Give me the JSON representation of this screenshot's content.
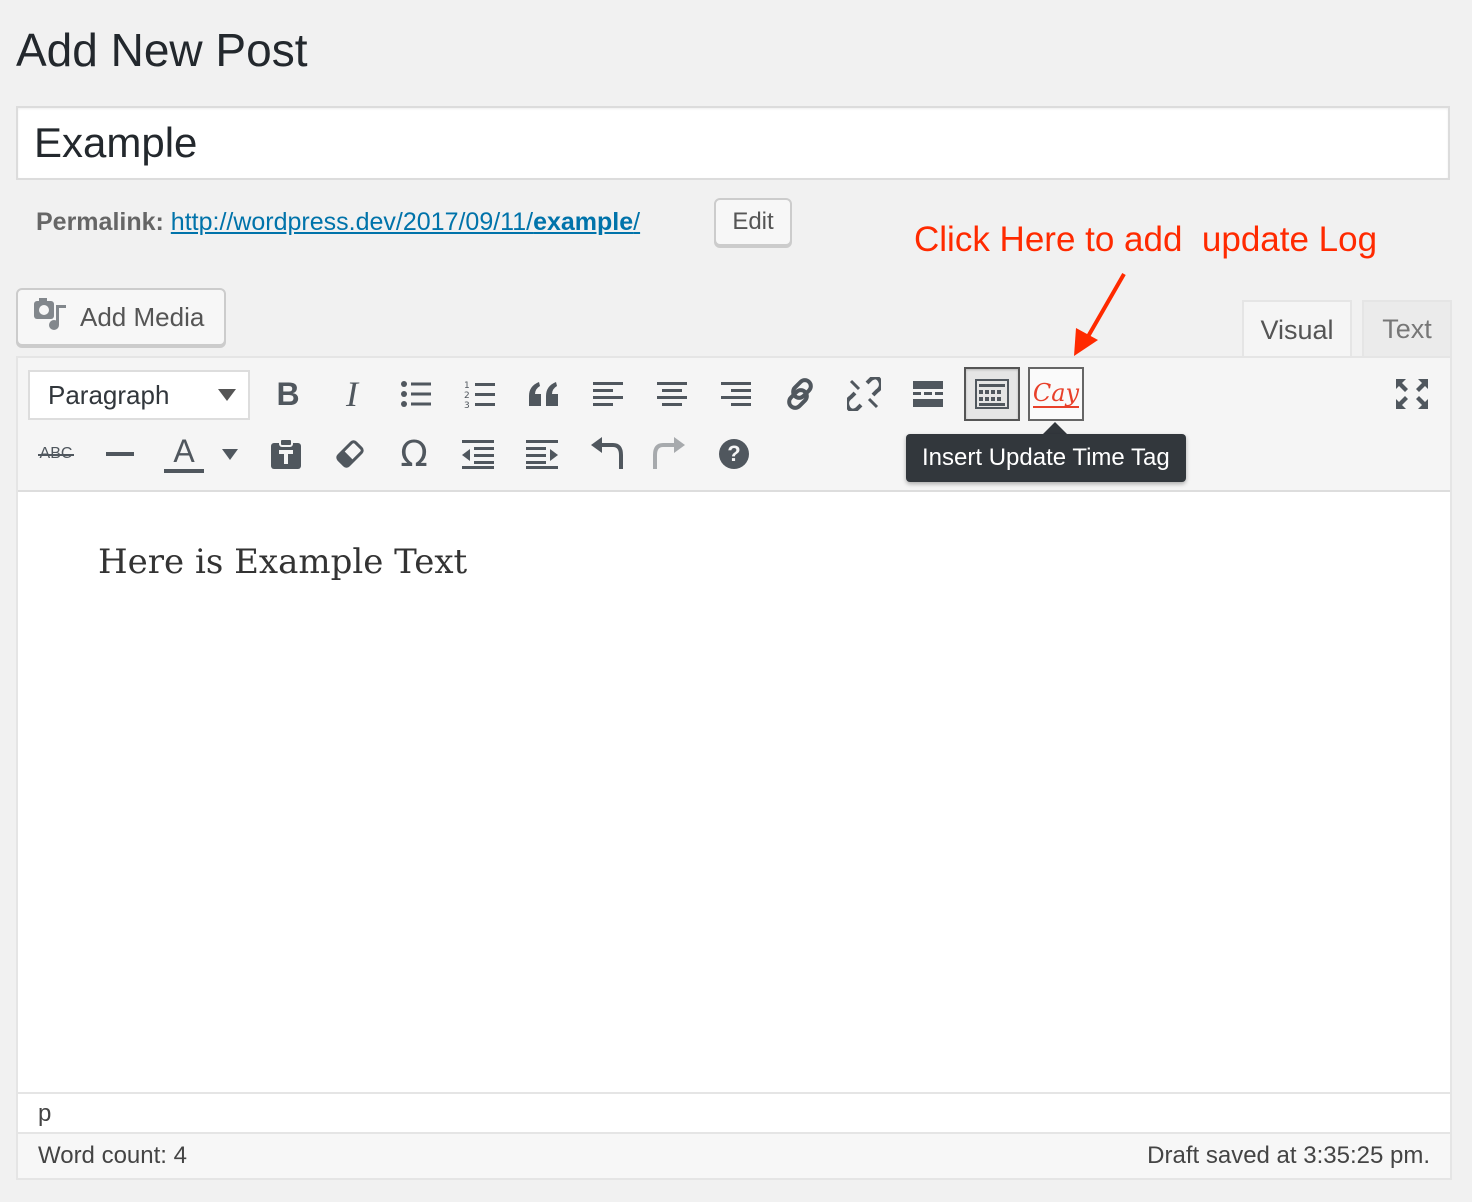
{
  "page": {
    "title": "Add New Post"
  },
  "post": {
    "title": "Example",
    "content": "Here is Example Text"
  },
  "permalink": {
    "label": "Permalink:",
    "url_prefix": "http://wordpress.dev/2017/09/11/",
    "url_slug": "example",
    "url_suffix": "/",
    "edit_label": "Edit"
  },
  "annotation": {
    "text": "Click Here to add  update Log",
    "color": "#ff2a00"
  },
  "media": {
    "add_media_label": "Add Media"
  },
  "editor_tabs": {
    "visual": "Visual",
    "text": "Text"
  },
  "toolbar": {
    "format_value": "Paragraph",
    "row1_icons": [
      "bold-icon",
      "italic-icon",
      "bullet-list-icon",
      "numbered-list-icon",
      "blockquote-icon",
      "align-left-icon",
      "align-center-icon",
      "align-right-icon",
      "link-icon",
      "unlink-icon",
      "read-more-icon",
      "toolbar-toggle-icon",
      "update-time-tag-icon",
      "fullscreen-icon"
    ],
    "row2_icons": [
      "strikethrough-icon",
      "horizontal-line-icon",
      "text-color-icon",
      "paste-as-text-icon",
      "clear-formatting-icon",
      "special-character-icon",
      "outdent-icon",
      "indent-icon",
      "undo-icon",
      "redo-icon",
      "help-icon"
    ],
    "strikethrough_text": "ABC",
    "text_color_letter": "A",
    "bold_letter": "B",
    "italic_letter": "I",
    "omega": "Ω",
    "help": "?",
    "tag_glyph": "Cay",
    "tooltip": "Insert Update Time Tag"
  },
  "status": {
    "path": "p",
    "word_count": "Word count: 4",
    "draft_saved": "Draft saved at 3:35:25 pm."
  }
}
